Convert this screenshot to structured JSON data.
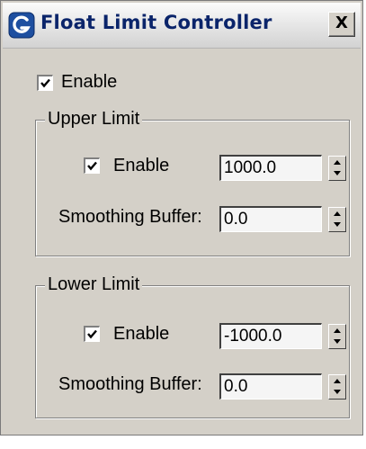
{
  "window": {
    "title": "Float Limit Controller",
    "close_glyph": "X",
    "app_icon": "3dsmax-logo-icon",
    "close_icon": "close-icon"
  },
  "enable": {
    "label": "Enable",
    "checked": true
  },
  "upper_limit": {
    "title": "Upper Limit",
    "enable_label": "Enable",
    "enable_checked": true,
    "value": "1000.0",
    "smoothing_label": "Smoothing Buffer:",
    "smoothing_value": "0.0"
  },
  "lower_limit": {
    "title": "Lower Limit",
    "enable_label": "Enable",
    "enable_checked": true,
    "value": "-1000.0",
    "smoothing_label": "Smoothing Buffer:",
    "smoothing_value": "0.0"
  },
  "colors": {
    "dialog_bg": "#d4d0c8",
    "title_text": "#0a246a",
    "icon_blue": "#1e4fa0"
  }
}
